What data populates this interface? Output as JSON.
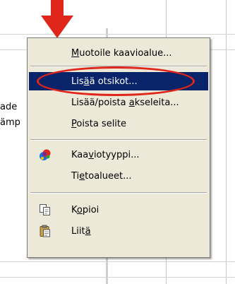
{
  "background": {
    "text_left_1": "ade",
    "text_left_2": "ämp"
  },
  "menu": {
    "items": [
      {
        "label_pre": "",
        "mnemonic": "M",
        "label_post": "uotoile kaavioalue...",
        "icon": ""
      },
      {
        "label_pre": "Lis",
        "mnemonic": "ä",
        "label_post": "ä otsikot...",
        "icon": ""
      },
      {
        "label_pre": "Lisää/poista ",
        "mnemonic": "a",
        "label_post": "kseleita...",
        "icon": ""
      },
      {
        "label_pre": "",
        "mnemonic": "P",
        "label_post": "oista selite",
        "icon": ""
      },
      {
        "label_pre": "Kaa",
        "mnemonic": "v",
        "label_post": "iotyyppi...",
        "icon": "chart-type-icon"
      },
      {
        "label_pre": "Ti",
        "mnemonic": "e",
        "label_post": "toalueet...",
        "icon": ""
      },
      {
        "label_pre": "K",
        "mnemonic": "o",
        "label_post": "pioi",
        "icon": "copy-icon"
      },
      {
        "label_pre": "Liit",
        "mnemonic": "ä",
        "label_post": "",
        "icon": "paste-icon"
      }
    ],
    "highlighted_index": 1
  },
  "colors": {
    "menu_bg": "#ece9d8",
    "highlight_bg": "#0a246a",
    "highlight_text": "#ffffff",
    "annotation_red": "#e0261b"
  }
}
